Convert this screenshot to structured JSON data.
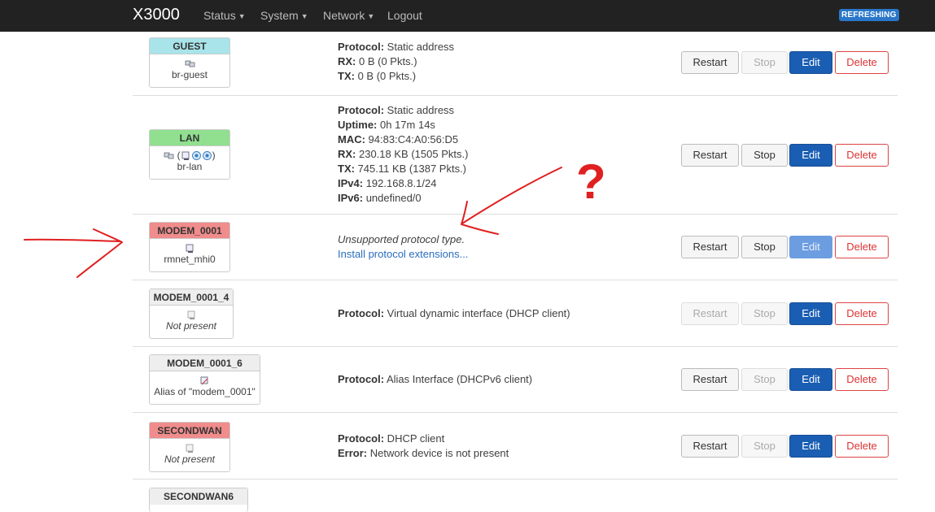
{
  "app": {
    "title": "X3000",
    "badge": "REFRESHING"
  },
  "nav": {
    "items": [
      "Status",
      "System",
      "Network",
      "Logout"
    ]
  },
  "buttons": {
    "restart": "Restart",
    "stop": "Stop",
    "edit": "Edit",
    "delete": "Delete"
  },
  "interfaces": [
    {
      "name": "GUEST",
      "header_color": "#a8e4ea",
      "device": "br-guest",
      "lines": [
        {
          "k": "Protocol:",
          "v": " Static address"
        },
        {
          "k": "RX:",
          "v": " 0 B (0 Pkts.)"
        },
        {
          "k": "TX:",
          "v": " 0 B (0 Pkts.)"
        }
      ],
      "stop_disabled": true,
      "restart_disabled": false,
      "edit_light": false
    },
    {
      "name": "LAN",
      "header_color": "#90e090",
      "device_prefix": "(",
      "device_suffix": ")",
      "device": "br-lan",
      "lines": [
        {
          "k": "Protocol:",
          "v": " Static address"
        },
        {
          "k": "Uptime:",
          "v": " 0h 17m 14s"
        },
        {
          "k": "MAC:",
          "v": " 94:83:C4:A0:56:D5"
        },
        {
          "k": "RX:",
          "v": " 230.18 KB (1505 Pkts.)"
        },
        {
          "k": "TX:",
          "v": " 745.11 KB (1387 Pkts.)"
        },
        {
          "k": "IPv4:",
          "v": " 192.168.8.1/24"
        },
        {
          "k": "IPv6:",
          "v": " undefined/0"
        }
      ],
      "stop_disabled": false,
      "restart_disabled": false,
      "edit_light": false
    },
    {
      "name": "MODEM_0001",
      "header_color": "#f08c8c",
      "device": "rmnet_mhi0",
      "message": "Unsupported protocol type.",
      "link": "Install protocol extensions...",
      "stop_disabled": false,
      "restart_disabled": false,
      "edit_light": true
    },
    {
      "name": "MODEM_0001_4",
      "header_color": "#eeeeee",
      "device": "Not present",
      "device_italic": true,
      "lines": [
        {
          "k": "Protocol:",
          "v": " Virtual dynamic interface (DHCP client)"
        }
      ],
      "stop_disabled": true,
      "restart_disabled": true,
      "edit_light": false
    },
    {
      "name": "MODEM_0001_6",
      "header_color": "#eeeeee",
      "device": "Alias of \"modem_0001\"",
      "lines": [
        {
          "k": "Protocol:",
          "v": " Alias Interface (DHCPv6 client)"
        }
      ],
      "stop_disabled": true,
      "restart_disabled": false,
      "edit_light": false
    },
    {
      "name": "SECONDWAN",
      "header_color": "#f08c8c",
      "device": "Not present",
      "device_italic": true,
      "lines": [
        {
          "k": "Protocol:",
          "v": " DHCP client"
        },
        {
          "k": "Error:",
          "v": " Network device is not present"
        }
      ],
      "stop_disabled": true,
      "restart_disabled": false,
      "edit_light": false
    },
    {
      "name": "SECONDWAN6",
      "header_color": "#eeeeee"
    }
  ],
  "annotation": {
    "question_mark": "?",
    "color": "#e02020"
  }
}
